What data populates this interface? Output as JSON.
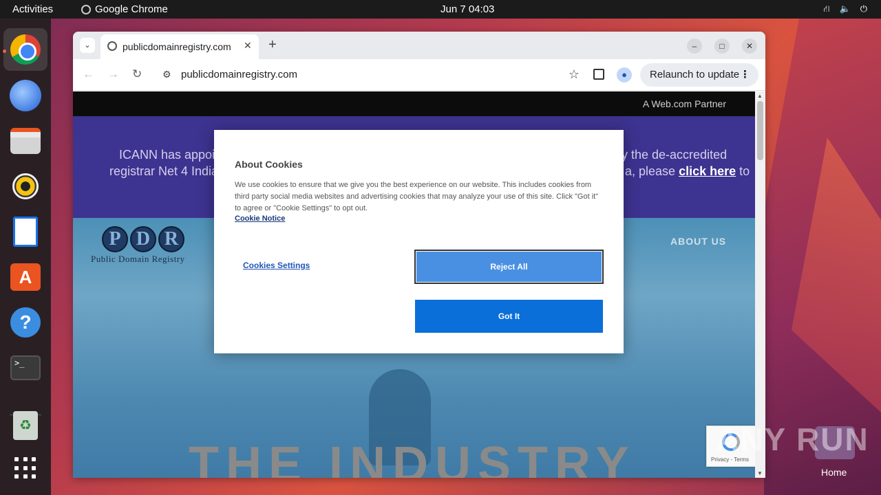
{
  "topbar": {
    "activities": "Activities",
    "app_name": "Google Chrome",
    "clock": "Jun 7  04:03"
  },
  "dock": {
    "items": [
      {
        "name": "chrome",
        "icon": "chrome-icon"
      },
      {
        "name": "thunderbird",
        "icon": "thunderbird-icon"
      },
      {
        "name": "files",
        "icon": "files-icon"
      },
      {
        "name": "rhythmbox",
        "icon": "rhythmbox-icon"
      },
      {
        "name": "writer",
        "icon": "writer-icon"
      },
      {
        "name": "app-center",
        "icon": "app-center-icon",
        "glyph": "A"
      },
      {
        "name": "help",
        "icon": "help-icon",
        "glyph": "?"
      },
      {
        "name": "terminal",
        "icon": "terminal-icon",
        "glyph": ">_"
      },
      {
        "name": "trash",
        "icon": "trash-icon",
        "glyph": "♻"
      },
      {
        "name": "show-apps",
        "icon": "grid-icon"
      }
    ]
  },
  "desktop": {
    "home_label": "Home"
  },
  "browser": {
    "tab_title": "publicdomainregistry.com",
    "tab_close": "✕",
    "new_tab": "+",
    "url": "publicdomainregistry.com",
    "relaunch_label": "Relaunch to update",
    "window_minimize": "–",
    "window_maximize": "□",
    "window_close": "✕"
  },
  "page": {
    "partner": "A Web.com Partner",
    "notice_line1_left": "ICANN has appoin",
    "notice_line1_right": "y the de-accredited",
    "notice_line2_left": "registrar Net 4 India",
    "notice_line2_right": "a, please",
    "notice_link": "click here",
    "notice_line2_end": "to",
    "logo_letters": [
      "P",
      "D",
      "R"
    ],
    "logo_tagline": "Public Domain Registry",
    "nav_about": "ABOUT US",
    "hero_text": "THE INDUSTRY",
    "recaptcha_text": "Privacy - Terms"
  },
  "cookie_dialog": {
    "heading": "About Cookies",
    "body": "We use cookies to ensure that we give you the best experience on our website. This includes cookies from third party social media websites and advertising cookies that may analyze your use of this site. Click \"Got it\" to agree or \"Cookie Settings\" to opt out.",
    "notice_link": "Cookie Notice",
    "settings_label": "Cookies Settings",
    "reject_label": "Reject All",
    "gotit_label": "Got It"
  },
  "watermark": "ANY RUN",
  "colors": {
    "notice_bg": "#3d3390",
    "button_primary": "#0a6fd9",
    "button_reject": "#4a90e2",
    "ubuntu_orange": "#e95420"
  }
}
